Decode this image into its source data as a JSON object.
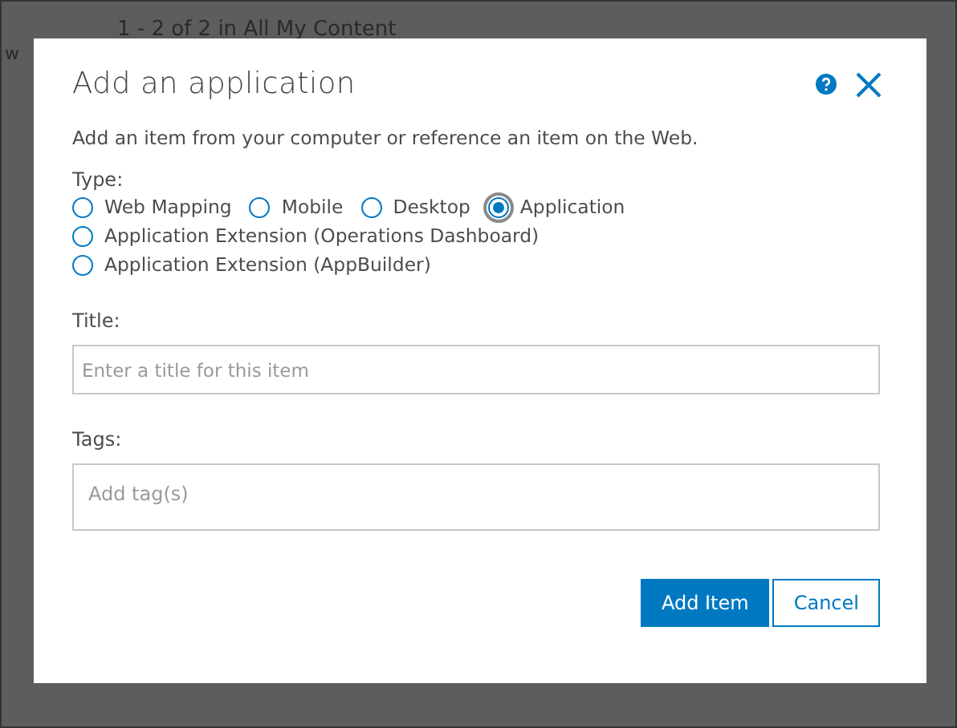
{
  "background": {
    "side_text": "w",
    "results_text": "1 - 2 of 2 in All My Content"
  },
  "dialog": {
    "title": "Add an application",
    "description": "Add an item from your computer or reference an item on the Web.",
    "type_label": "Type:",
    "types": [
      {
        "label": "Web Mapping",
        "selected": false
      },
      {
        "label": "Mobile",
        "selected": false
      },
      {
        "label": "Desktop",
        "selected": false
      },
      {
        "label": "Application",
        "selected": true
      },
      {
        "label": "Application Extension (Operations Dashboard)",
        "selected": false
      },
      {
        "label": "Application Extension (AppBuilder)",
        "selected": false
      }
    ],
    "title_field": {
      "label": "Title:",
      "placeholder": "Enter a title for this item"
    },
    "tags_field": {
      "label": "Tags:",
      "placeholder": "Add tag(s)"
    },
    "buttons": [
      {
        "label": "Add Item",
        "kind": "primary"
      },
      {
        "label": "Cancel",
        "kind": "secondary"
      }
    ]
  }
}
